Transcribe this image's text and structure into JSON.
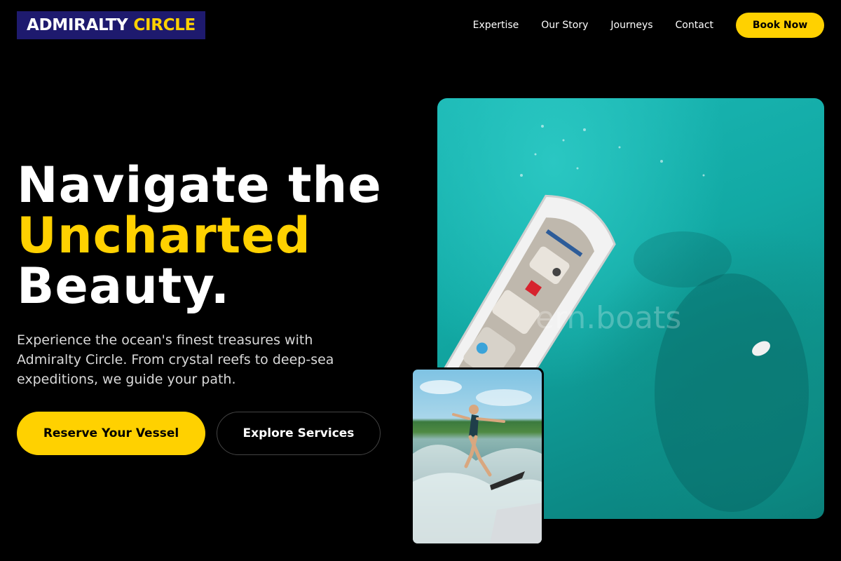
{
  "brand": {
    "name_part1": "ADMIRALTY",
    "name_part2": "CIRCLE"
  },
  "nav": {
    "items": [
      {
        "label": "Expertise"
      },
      {
        "label": "Our Story"
      },
      {
        "label": "Journeys"
      },
      {
        "label": "Contact"
      }
    ],
    "cta_label": "Book Now"
  },
  "hero": {
    "headline_line1": "Navigate the",
    "headline_line2": "Uncharted",
    "headline_line3": "Beauty.",
    "lead": "Experience the ocean's finest treasures with Admiralty Circle. From crystal reefs to deep-sea expeditions, we guide your path.",
    "primary_button": "Reserve Your Vessel",
    "secondary_button": "Explore Services"
  },
  "images": {
    "main_watermark": "ern.boats"
  },
  "colors": {
    "accent": "#ffd100",
    "logo_bg": "#1e1a6e",
    "background": "#000000"
  }
}
